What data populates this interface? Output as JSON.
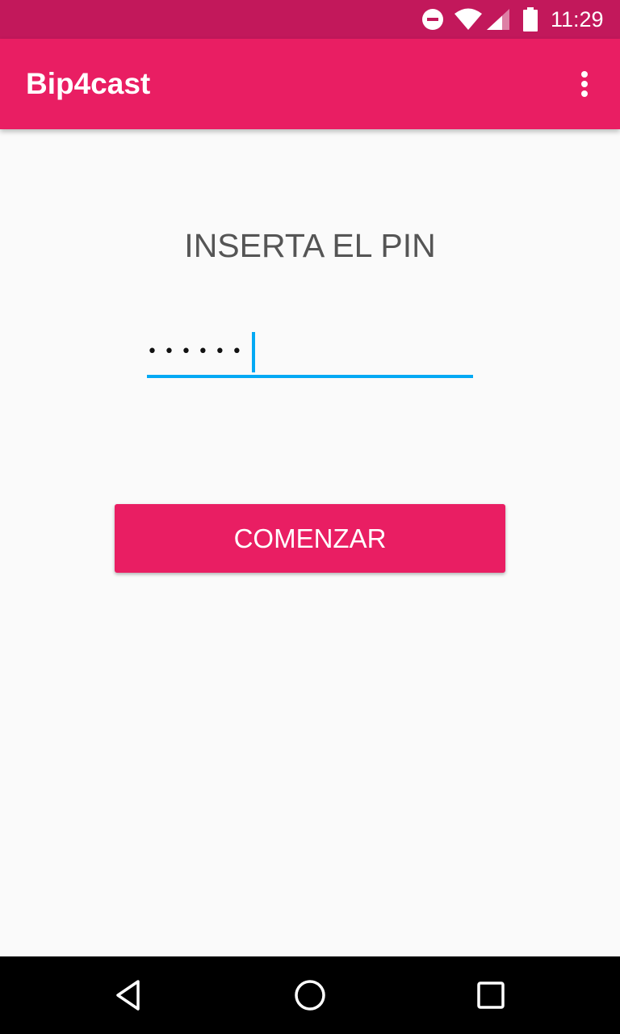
{
  "status_bar": {
    "time": "11:29",
    "icons": [
      "do-not-disturb-icon",
      "wifi-icon",
      "cell-signal-icon",
      "battery-icon"
    ],
    "background_color": "#c2185b"
  },
  "app_bar": {
    "title": "Bip4cast",
    "overflow_icon": "more-vert-icon",
    "background_color": "#e91e63"
  },
  "main": {
    "heading": "INSERTA EL PIN",
    "pin_input": {
      "masked_value": "••••••",
      "accent_color": "#03a9f4"
    },
    "start_button_label": "COMENZAR"
  },
  "nav_bar": {
    "icons": [
      "back-icon",
      "home-icon",
      "recents-icon"
    ]
  }
}
